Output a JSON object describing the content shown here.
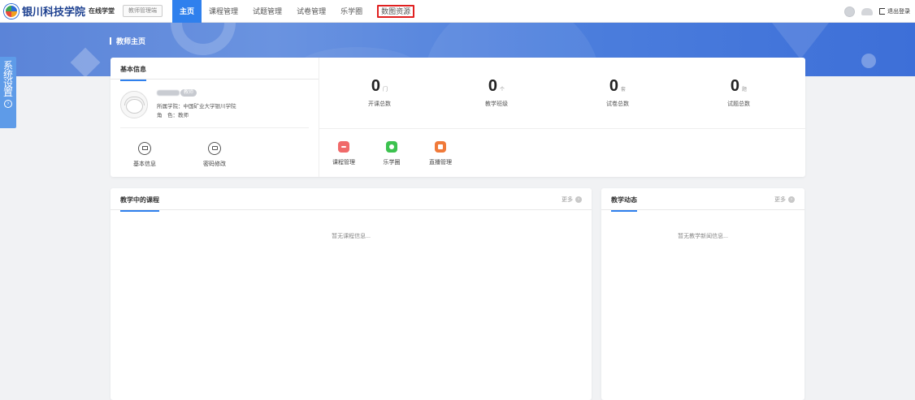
{
  "header": {
    "logo_text": "银川科技学院",
    "logo_sub": "在线学堂",
    "portal_button": "教师管理端",
    "nav": [
      {
        "label": "主页",
        "active": true
      },
      {
        "label": "课程管理"
      },
      {
        "label": "试题管理"
      },
      {
        "label": "试卷管理"
      },
      {
        "label": "乐学圈"
      },
      {
        "label": "数图资源",
        "highlighted": true
      }
    ],
    "logout": "退出登录"
  },
  "banner": {
    "title": "教师主页"
  },
  "side_tab": {
    "label": "系统设置"
  },
  "profile": {
    "section_title": "基本信息",
    "role_badge": "教师",
    "college": "所属学院：中国矿业大学银川学院",
    "role": "角　色：教师",
    "quick_links": [
      {
        "label": "基本信息",
        "icon": "id-card-icon"
      },
      {
        "label": "密码修改",
        "icon": "lock-icon"
      }
    ]
  },
  "stats": [
    {
      "value": "0",
      "unit": "门",
      "label": "开课总数"
    },
    {
      "value": "0",
      "unit": "个",
      "label": "教学班级"
    },
    {
      "value": "0",
      "unit": "套",
      "label": "试卷总数"
    },
    {
      "value": "0",
      "unit": "题",
      "label": "试题总数"
    }
  ],
  "apps": [
    {
      "label": "课程管理",
      "color": "#f06a6a",
      "icon": "list-icon"
    },
    {
      "label": "乐学圈",
      "color": "#3cc24f",
      "icon": "chat-icon"
    },
    {
      "label": "直播管理",
      "color": "#f07a3a",
      "icon": "live-icon"
    }
  ],
  "courses": {
    "title": "教学中的课程",
    "more": "更多",
    "empty": "暂无课程信息..."
  },
  "news": {
    "title": "教学动态",
    "more": "更多",
    "empty": "暂无教学新闻信息..."
  }
}
